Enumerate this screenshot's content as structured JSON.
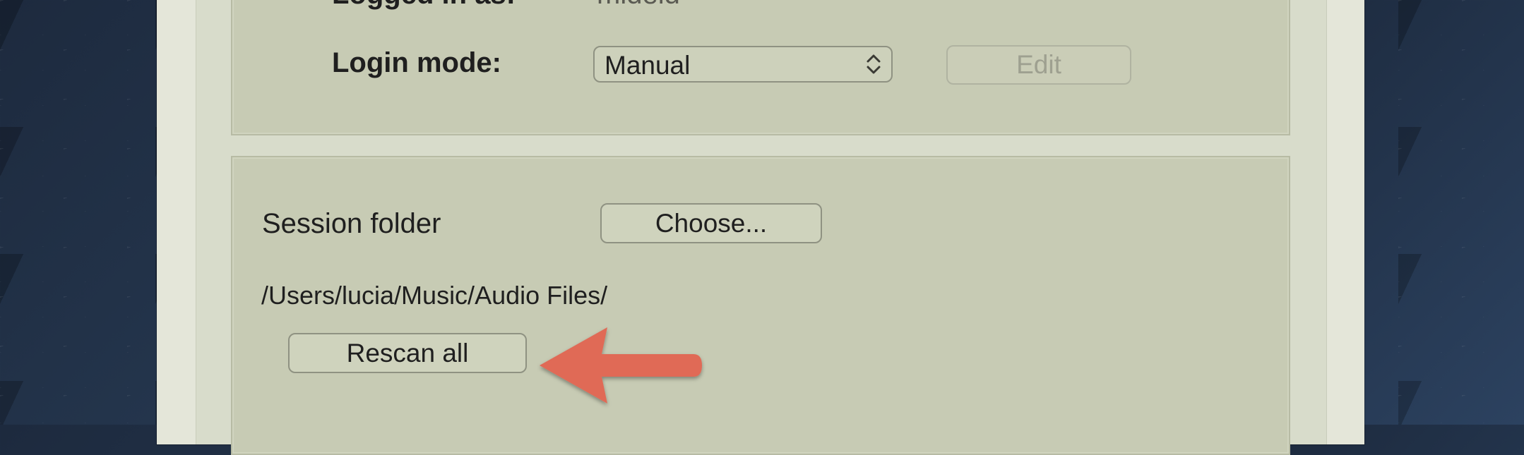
{
  "account": {
    "logged_in_label": "Logged in as:",
    "logged_in_value": "mideld",
    "login_mode_label": "Login mode:",
    "login_mode_value": "Manual",
    "edit_label": "Edit"
  },
  "session": {
    "folder_label": "Session folder",
    "choose_label": "Choose...",
    "path": "/Users/lucia/Music/Audio Files/",
    "rescan_label": "Rescan all"
  },
  "annotation": {
    "arrow_color": "#e06a56",
    "arrow_points_to": "Rescan all"
  },
  "colors": {
    "panel_bg": "#c7cbb4",
    "window_bg": "#e4e6d9",
    "desktop_bg": "#1d2a3e"
  }
}
